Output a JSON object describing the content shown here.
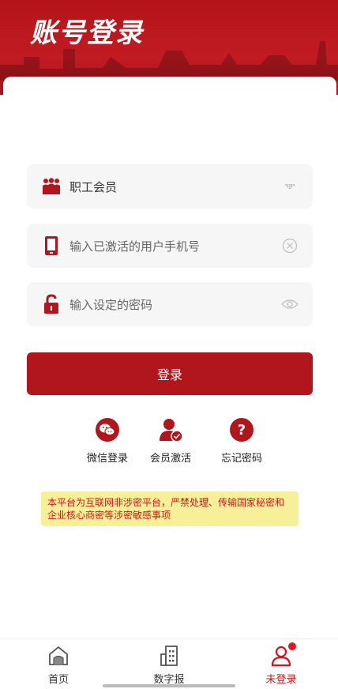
{
  "header": {
    "title": "账号登录"
  },
  "form": {
    "member_type": "职工会员",
    "phone_placeholder": "输入已激活的用户手机号",
    "password_placeholder": "输入设定的密码",
    "login_label": "登录"
  },
  "quick_actions": [
    {
      "label": "微信登录",
      "icon": "wechat-icon"
    },
    {
      "label": "会员激活",
      "icon": "member-activate-icon"
    },
    {
      "label": "忘记密码",
      "icon": "question-icon"
    }
  ],
  "notice": "本平台为互联网非涉密平台，严禁处理、传输国家秘密和企业核心商密等涉密敏感事项",
  "tabbar": {
    "items": [
      {
        "label": "首页",
        "icon": "home-icon"
      },
      {
        "label": "数字报",
        "icon": "building-icon"
      },
      {
        "label": "未登录",
        "icon": "user-icon"
      }
    ]
  },
  "colors": {
    "brand_red": "#b1161c",
    "alert_red": "#d6131c",
    "notice_bg": "#f6f198"
  }
}
